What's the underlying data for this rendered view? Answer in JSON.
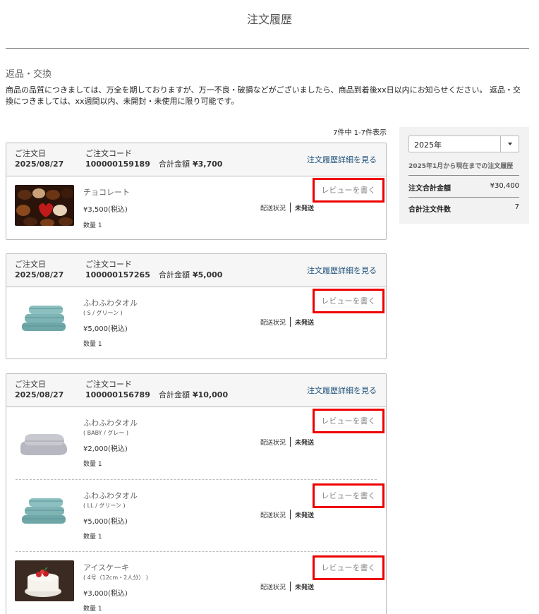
{
  "page": {
    "title": "注文履歴"
  },
  "notice": {
    "title": "返品・交換",
    "text": "商品の品質につきましては、万全を期しておりますが、万一不良・破損などがございましたら、商品到着後xx日以内にお知らせください。 返品・交換につきましては、xx週間以内、未開封・未使用に限り可能です。"
  },
  "pager": "7件中 1-7件表示",
  "labels": {
    "order_date": "ご注文日",
    "order_code": "ご注文コード",
    "total": "合計金額",
    "detail_link": "注文履歴詳細を見る",
    "shipping_status": "配送状況",
    "review": "レビューを書く",
    "qty_prefix": "数量"
  },
  "orders": [
    {
      "date": "2025/08/27",
      "code": "100000159189",
      "total": "¥3,700",
      "items": [
        {
          "name": "チョコレート",
          "variant": "",
          "price": "¥3,500(税込)",
          "qty": "数量 1",
          "status": "未発送",
          "image": "chocolate"
        }
      ]
    },
    {
      "date": "2025/08/27",
      "code": "100000157265",
      "total": "¥5,000",
      "items": [
        {
          "name": "ふわふわタオル",
          "variant": "( S / グリーン )",
          "price": "¥5,000(税込)",
          "qty": "数量 1",
          "status": "未発送",
          "image": "towel-green"
        }
      ]
    },
    {
      "date": "2025/08/27",
      "code": "100000156789",
      "total": "¥10,000",
      "items": [
        {
          "name": "ふわふわタオル",
          "variant": "( BABY / グレー )",
          "price": "¥2,000(税込)",
          "qty": "数量 1",
          "status": "未発送",
          "image": "towel-gray"
        },
        {
          "name": "ふわふわタオル",
          "variant": "( LL / グリーン )",
          "price": "¥5,000(税込)",
          "qty": "数量 1",
          "status": "未発送",
          "image": "towel-green"
        },
        {
          "name": "アイスケーキ",
          "variant": "( 4号（12cm・2人分） )",
          "price": "¥3,000(税込)",
          "qty": "数量 1",
          "status": "未発送",
          "image": "cake"
        }
      ]
    }
  ],
  "sidebar": {
    "year": "2025年",
    "note": "2025年1月から現在までの注文履歴",
    "total_label": "注文合計金額",
    "total_value": "¥30,400",
    "count_label": "合計注文件数",
    "count_value": "7"
  },
  "colors": {
    "review_border": "#e00000",
    "link": "#1a4f7a",
    "header_bg": "#f6f6f6"
  }
}
